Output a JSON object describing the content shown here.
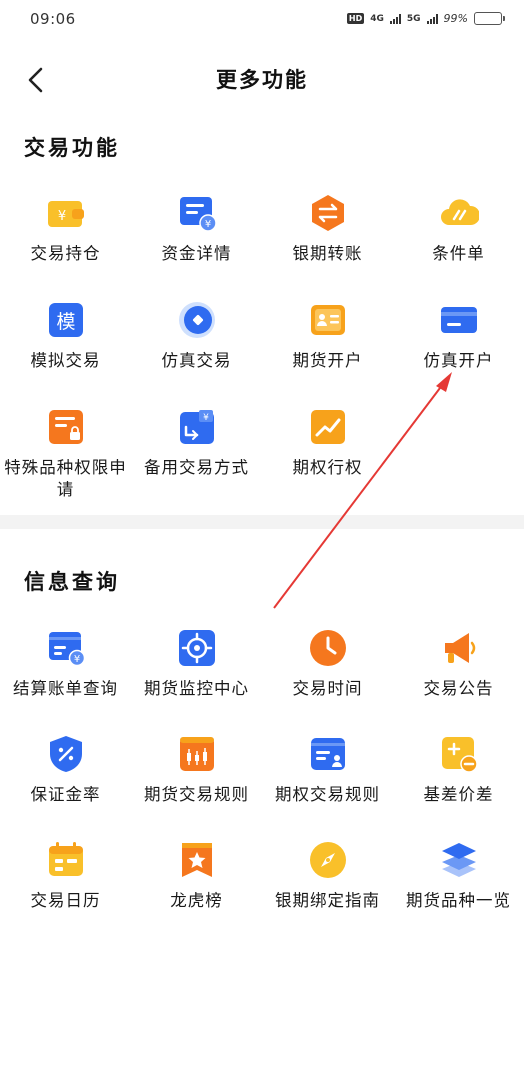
{
  "status_bar": {
    "time": "09:06",
    "hd_badge": "HD",
    "net_1": "4G",
    "net_2": "5G",
    "battery_text": "99%",
    "battery_level": 0.99
  },
  "nav": {
    "title": "更多功能",
    "back_icon": "chevron-left-icon"
  },
  "trade_section": {
    "title": "交易功能",
    "items": [
      {
        "label": "交易持仓",
        "icon": "wallet-yuan-icon"
      },
      {
        "label": "资金详情",
        "icon": "fund-detail-icon"
      },
      {
        "label": "银期转账",
        "icon": "transfer-icon"
      },
      {
        "label": "条件单",
        "icon": "cloud-condition-icon"
      },
      {
        "label": "模拟交易",
        "icon": "simulate-icon"
      },
      {
        "label": "仿真交易",
        "icon": "circle-diamond-icon"
      },
      {
        "label": "期货开户",
        "icon": "id-card-icon"
      },
      {
        "label": "仿真开户",
        "icon": "card-icon"
      },
      {
        "label": "特殊品种权限申请",
        "icon": "lock-doc-icon"
      },
      {
        "label": "备用交易方式",
        "icon": "backup-trade-icon"
      },
      {
        "label": "期权行权",
        "icon": "trend-up-icon"
      }
    ]
  },
  "info_section": {
    "title": "信息查询",
    "items": [
      {
        "label": "结算账单查询",
        "icon": "bill-icon"
      },
      {
        "label": "期货监控中心",
        "icon": "target-icon"
      },
      {
        "label": "交易时间",
        "icon": "clock-icon"
      },
      {
        "label": "交易公告",
        "icon": "megaphone-icon"
      },
      {
        "label": "保证金率",
        "icon": "shield-percent-icon"
      },
      {
        "label": "期货交易规则",
        "icon": "candlestick-doc-icon"
      },
      {
        "label": "期权交易规则",
        "icon": "rule-card-icon"
      },
      {
        "label": "基差价差",
        "icon": "plus-minus-icon"
      },
      {
        "label": "交易日历",
        "icon": "calendar-icon"
      },
      {
        "label": "龙虎榜",
        "icon": "star-banner-icon"
      },
      {
        "label": "银期绑定指南",
        "icon": "compass-icon"
      },
      {
        "label": "期货品种一览",
        "icon": "layers-icon"
      }
    ]
  },
  "icon_text": {
    "simulate": "模",
    "wallet": "¥",
    "fund": "¥",
    "bill": "¥",
    "backup": "¥"
  },
  "colors": {
    "blue": "#2f6bf0",
    "orange": "#f7a21b",
    "yellow": "#f9c02a",
    "deep_orange": "#f5771e",
    "arrow_red": "#e53935"
  }
}
